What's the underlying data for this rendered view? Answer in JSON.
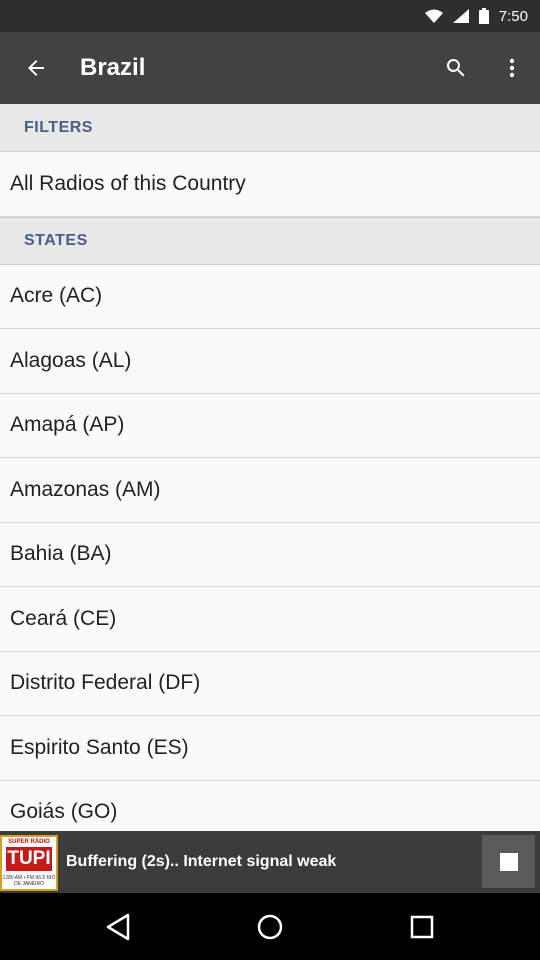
{
  "status_bar": {
    "time": "7:50"
  },
  "app_bar": {
    "title": "Brazil",
    "back_icon": "arrow-back-icon",
    "search_icon": "search-icon",
    "more_icon": "more-vert-icon"
  },
  "filters": {
    "header": "FILTERS",
    "items": [
      {
        "label": "All Radios of this Country"
      }
    ]
  },
  "states": {
    "header": "STATES",
    "items": [
      {
        "label": "Acre (AC)"
      },
      {
        "label": "Alagoas (AL)"
      },
      {
        "label": "Amapá (AP)"
      },
      {
        "label": "Amazonas (AM)"
      },
      {
        "label": "Bahia (BA)"
      },
      {
        "label": "Ceará (CE)"
      },
      {
        "label": "Distrito Federal (DF)"
      },
      {
        "label": "Espirito Santo (ES)"
      },
      {
        "label": "Goiás (GO)"
      }
    ]
  },
  "player": {
    "logo_top": "SUPER RÁDIO",
    "logo_name": "TUPI",
    "logo_bottom": "1280 AM • FM 96.5 RIO DE JANEIRO",
    "message": "Buffering (2s).. Internet signal weak",
    "stop_icon": "stop-icon"
  },
  "colors": {
    "app_bar": "#424242",
    "status_bar": "#2e2e2e",
    "section_header_text": "#4a5d8a",
    "player_bg": "#3b3b3b"
  }
}
